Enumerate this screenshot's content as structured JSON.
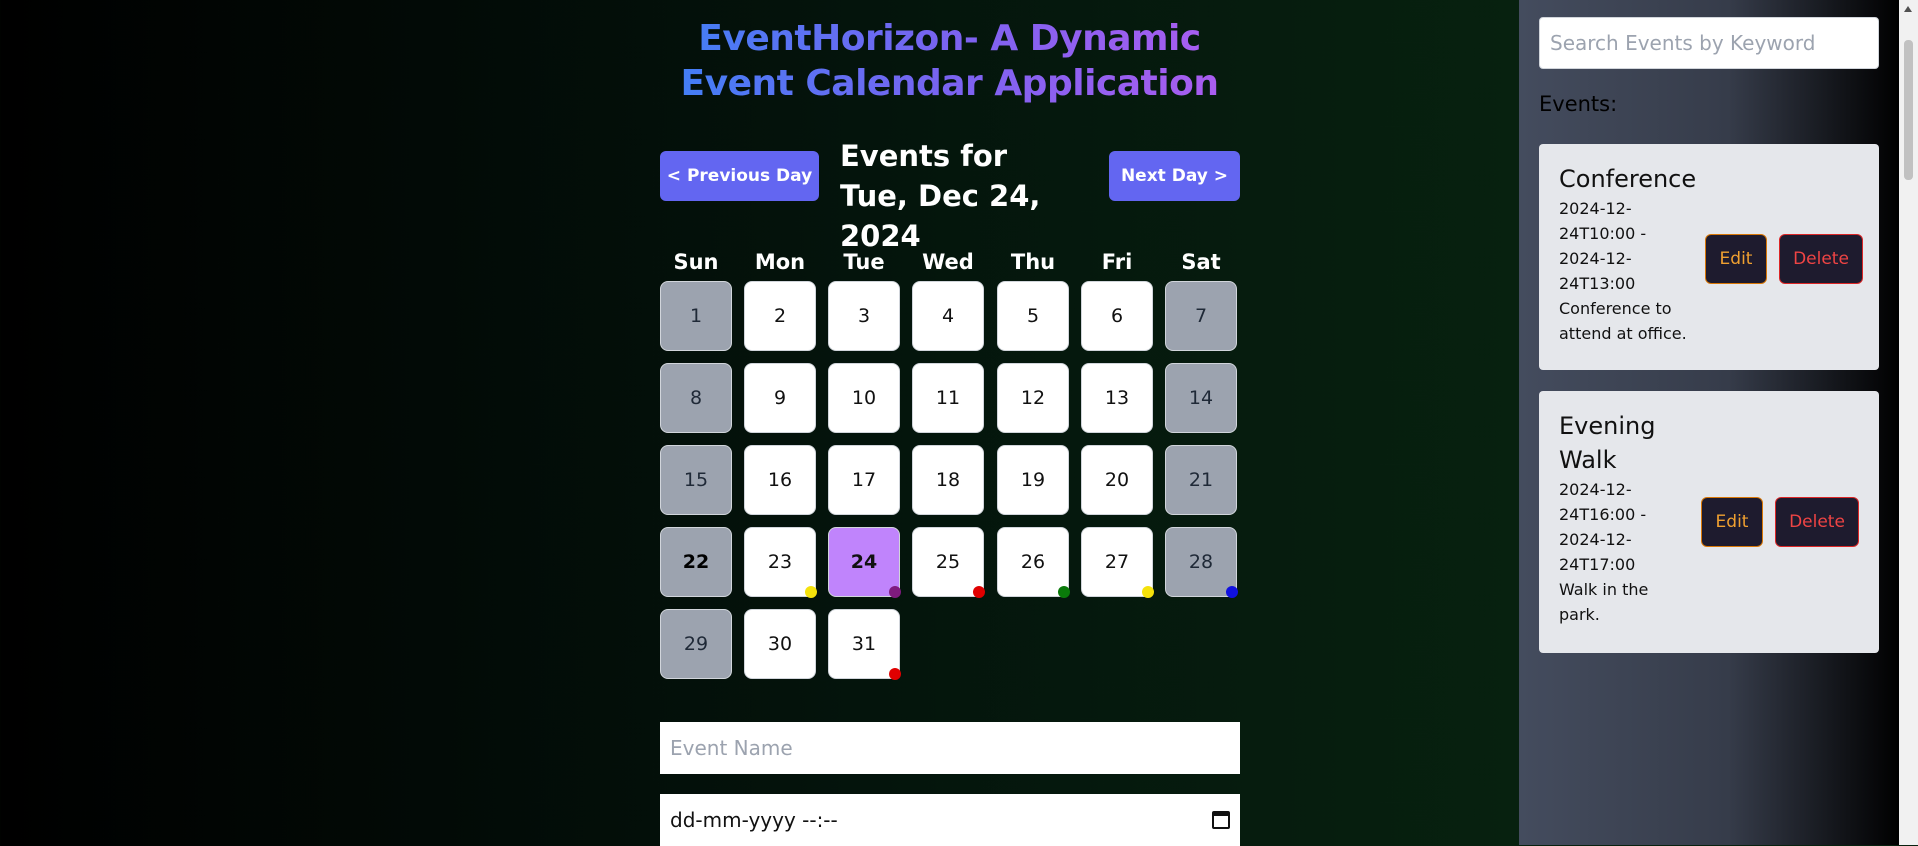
{
  "app": {
    "title": "EventHorizon- A Dynamic Event Calendar Application"
  },
  "nav": {
    "prev_label": "< Previous Day",
    "next_label": "Next Day >",
    "heading": "Events for Tue, Dec 24, 2024"
  },
  "calendar": {
    "weekdays": [
      "Sun",
      "Mon",
      "Tue",
      "Wed",
      "Thu",
      "Fri",
      "Sat"
    ],
    "weeks": [
      [
        "1",
        "2",
        "3",
        "4",
        "5",
        "6",
        "7"
      ],
      [
        "8",
        "9",
        "10",
        "11",
        "12",
        "13",
        "14"
      ],
      [
        "15",
        "16",
        "17",
        "18",
        "19",
        "20",
        "21"
      ],
      [
        "22",
        "23",
        "24",
        "25",
        "26",
        "27",
        "28"
      ],
      [
        "29",
        "30",
        "31"
      ]
    ],
    "today": "22",
    "selected": "24",
    "markers": {
      "23": "#f5e20b",
      "24": "#7e1b7e",
      "25": "#e00000",
      "26": "#0a7a0a",
      "27": "#f5e20b",
      "28": "#1010e0",
      "31": "#e00000"
    }
  },
  "form": {
    "name_placeholder": "Event Name",
    "datetime_placeholder": "dd-mm-yyyy --:--"
  },
  "sidebar": {
    "search_placeholder": "Search Events by Keyword",
    "events_label": "Events:",
    "events": [
      {
        "name": "Conference",
        "time_lines": [
          "2024-12-",
          "24T10:00 -",
          "2024-12-",
          "24T13:00"
        ],
        "desc_lines": [
          "Conference to",
          "attend at office."
        ],
        "edit_label": "Edit",
        "delete_label": "Delete"
      },
      {
        "name_lines": [
          "Evening",
          "Walk"
        ],
        "time_lines": [
          "2024-12-",
          "24T16:00 -",
          "2024-12-",
          "24T17:00"
        ],
        "desc_lines": [
          "Walk in the",
          "park."
        ],
        "edit_label": "Edit",
        "delete_label": "Delete"
      }
    ]
  },
  "colors": {
    "accent": "#6366f1",
    "selected_day": "#c084fc",
    "weekend": "#9ca3af"
  }
}
